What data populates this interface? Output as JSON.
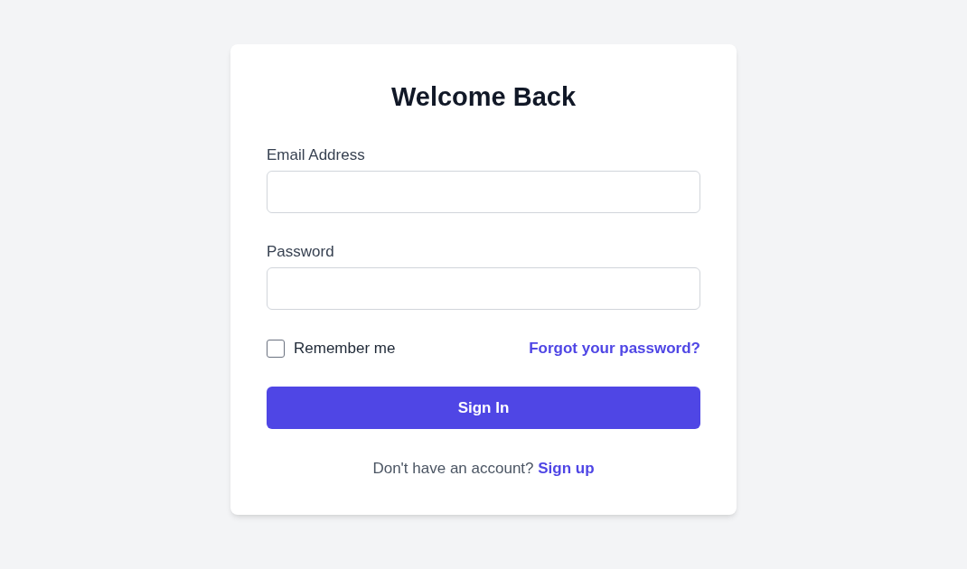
{
  "form": {
    "title": "Welcome Back",
    "fields": [
      {
        "label": "Email Address"
      },
      {
        "label": "Password"
      }
    ],
    "remember": {
      "label": "Remember me",
      "checked": false
    },
    "forgot_link": "Forgot your password?",
    "submit_button": "Sign In",
    "signup": {
      "prompt": "Don't have an account?",
      "link": "Sign up"
    }
  }
}
